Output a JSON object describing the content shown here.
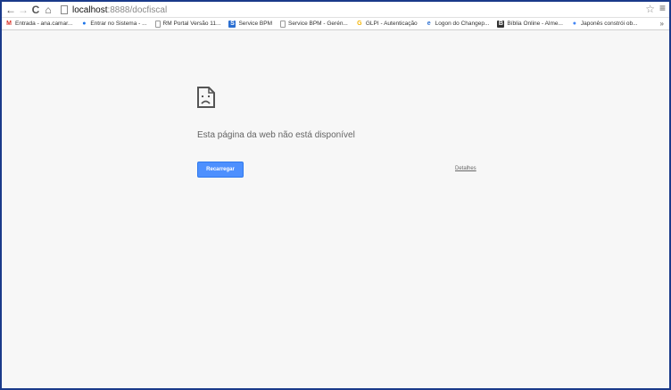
{
  "toolbar": {
    "back_icon": "←",
    "forward_icon": "→",
    "reload_icon": "C",
    "home_icon": "⌂",
    "url_host": "localhost",
    "url_path": ":8888/docfiscal",
    "star_icon": "☆",
    "menu_icon": "≡"
  },
  "bookmarks": {
    "items": [
      {
        "label": "Entrada - ana.camar...",
        "icon": "M",
        "color": "#d93025"
      },
      {
        "label": "Entrar no Sistema - ...",
        "icon": "●",
        "color": "#1a73e8"
      },
      {
        "label": "RM Portal Versão 11...",
        "icon": "",
        "color": "#888888"
      },
      {
        "label": "Service BPM",
        "icon": "S",
        "color": "#2a6ed1"
      },
      {
        "label": "Service BPM - Gerén...",
        "icon": "",
        "color": "#888888"
      },
      {
        "label": "GLPI - Autenticação",
        "icon": "G",
        "color": "#f4b400"
      },
      {
        "label": "Logon do Changep...",
        "icon": "e",
        "color": "#2a6ed1"
      },
      {
        "label": "Bíblia Online - Alme...",
        "icon": "B",
        "color": "#333333"
      },
      {
        "label": "Japonês constrói ob...",
        "icon": "●",
        "color": "#4285f4"
      }
    ],
    "more": "»"
  },
  "error": {
    "title": "Esta página da web não está disponível",
    "reload_label": "Recarregar",
    "details_label": "Detalhes"
  },
  "colors": {
    "accent": "#4d90fe",
    "frame_border": "#1a3a8a"
  }
}
